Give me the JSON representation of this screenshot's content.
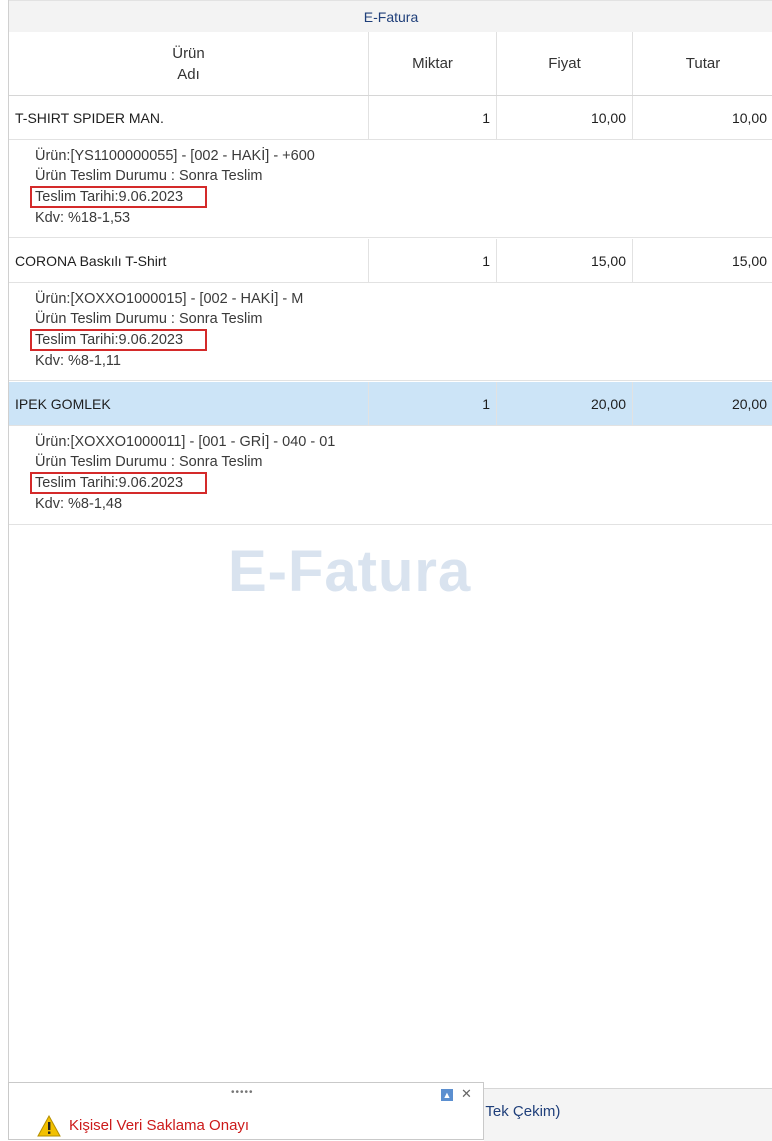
{
  "title": "E-Fatura",
  "columns": {
    "name": "Ürün\nAdı",
    "qty": "Miktar",
    "price": "Fiyat",
    "total": "Tutar"
  },
  "items": [
    {
      "name": "T-SHIRT SPIDER MAN.",
      "qty": "1",
      "price": "10,00",
      "total": "10,00",
      "product": "Ürün:[YS1100000055] - [002 - HAKİ] - +600",
      "status": "Ürün Teslim Durumu : Sonra Teslim",
      "delivery": "Teslim Tarihi:9.06.2023",
      "vat": "Kdv: %18-1,53"
    },
    {
      "name": "CORONA Baskılı T-Shirt",
      "qty": "1",
      "price": "15,00",
      "total": "15,00",
      "product": "Ürün:[XOXXO1000015] - [002 - HAKİ] - M",
      "status": "Ürün Teslim Durumu : Sonra Teslim",
      "delivery": "Teslim Tarihi:9.06.2023",
      "vat": "Kdv: %8-1,11"
    },
    {
      "name": "IPEK GOMLEK",
      "qty": "1",
      "price": "20,00",
      "total": "20,00",
      "product": "Ürün:[XOXXO1000011] - [001 - GRİ] - 040 - 01",
      "status": "Ürün Teslim Durumu : Sonra Teslim",
      "delivery": "Teslim Tarihi:9.06.2023",
      "vat": "Kdv: %8-1,48"
    }
  ],
  "watermark": "E-Fatura",
  "notification": {
    "text": "Kişisel Veri Saklama Onayı",
    "grip": "•••••"
  },
  "bottom_button": "lı Tek Çekim)",
  "colors": {
    "highlight_border": "#d42a2a",
    "selected_row": "#cce4f7",
    "title_text": "#1f3f7a"
  }
}
